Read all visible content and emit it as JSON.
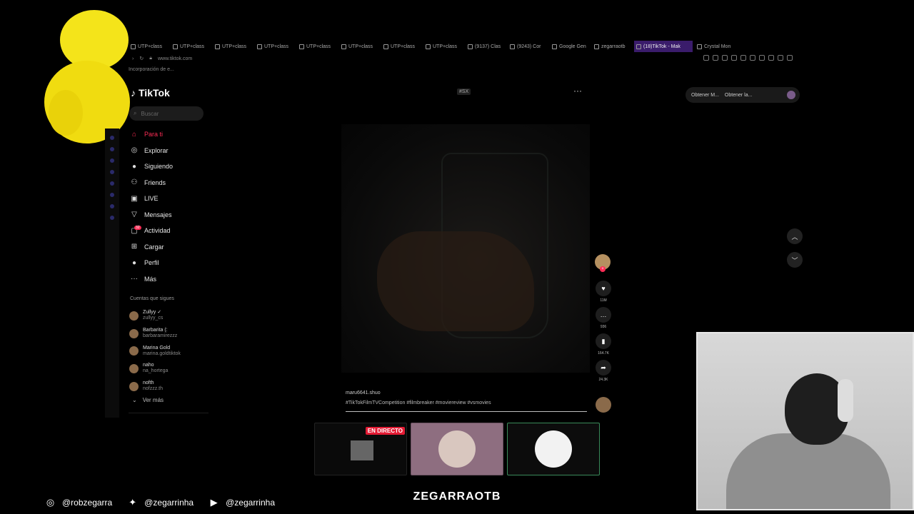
{
  "browser": {
    "tabs": [
      {
        "label": "UTP+class",
        "active": false
      },
      {
        "label": "UTP+class",
        "active": false
      },
      {
        "label": "UTP+class",
        "active": false
      },
      {
        "label": "UTP+class",
        "active": false
      },
      {
        "label": "UTP+class",
        "active": false
      },
      {
        "label": "UTP+class",
        "active": false
      },
      {
        "label": "UTP+class",
        "active": false
      },
      {
        "label": "UTP+class",
        "active": false
      },
      {
        "label": "(9137) Clas",
        "active": false
      },
      {
        "label": "(9243) Cor",
        "active": false
      },
      {
        "label": "Google Gen",
        "active": false
      },
      {
        "label": "zegarraotb",
        "active": false
      },
      {
        "label": "(18)TikTok - Mak",
        "active": true
      },
      {
        "label": "Crystal Mon",
        "active": false
      }
    ],
    "url": "www.tiktok.com",
    "bookmark": "Incorporación de e..."
  },
  "tiktok": {
    "logo": "TikTok",
    "search_placeholder": "Buscar",
    "nav": [
      {
        "label": "Para ti",
        "icon": "home-icon",
        "glyph": "⌂",
        "active": true
      },
      {
        "label": "Explorar",
        "icon": "compass-icon",
        "glyph": "◎",
        "active": false
      },
      {
        "label": "Siguiendo",
        "icon": "following-avatar-icon",
        "glyph": "●",
        "active": false
      },
      {
        "label": "Friends",
        "icon": "friends-icon",
        "glyph": "⚇",
        "active": false
      },
      {
        "label": "LIVE",
        "icon": "live-icon",
        "glyph": "▣",
        "active": false
      },
      {
        "label": "Mensajes",
        "icon": "messages-icon",
        "glyph": "▽",
        "active": false
      },
      {
        "label": "Actividad",
        "icon": "activity-icon",
        "glyph": "▢",
        "active": false,
        "badge": "32"
      },
      {
        "label": "Cargar",
        "icon": "upload-icon",
        "glyph": "⊞",
        "active": false
      },
      {
        "label": "Perfil",
        "icon": "profile-avatar-icon",
        "glyph": "●",
        "active": false
      },
      {
        "label": "Más",
        "icon": "more-icon",
        "glyph": "···",
        "active": false
      }
    ],
    "following_title": "Cuentas que sigues",
    "accounts": [
      {
        "name": "Zullyy ✓",
        "user": "zullyy_cs"
      },
      {
        "name": "Barbarita (:",
        "user": "barbaramirezzz"
      },
      {
        "name": "Marina Gold",
        "user": "marina.goldtiktok"
      },
      {
        "name": "naho",
        "user": "na_hortega"
      },
      {
        "name": "nofth",
        "user": "nofzzz.th"
      }
    ],
    "see_more": "Ver más",
    "top_right": {
      "btn1": "Obtener M...",
      "btn2": "Obtener la..."
    },
    "fx_tag": "#SX",
    "video": {
      "author": "maru6641.shuo",
      "tags": "#TikTokFilmTVCompetition #filmbreaker #moviereview #vsmovies"
    },
    "actions": {
      "likes": "11M",
      "comments": "936",
      "saves": "164.7K",
      "shares": "24.3K"
    }
  },
  "stream": {
    "live_badge": "EN DIRECTO",
    "channel": "ZEGARRAOTB",
    "socials": [
      {
        "icon": "instagram-icon",
        "glyph": "◎",
        "handle": "@robzegarra"
      },
      {
        "icon": "twitter-icon",
        "glyph": "✦",
        "handle": "@zegarrinha"
      },
      {
        "icon": "youtube-icon",
        "glyph": "▶",
        "handle": "@zegarrinha"
      }
    ]
  }
}
